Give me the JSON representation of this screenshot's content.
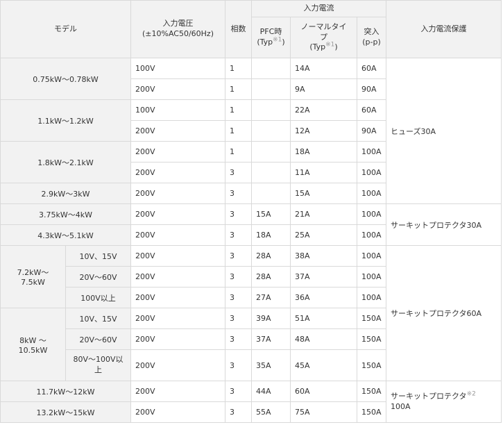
{
  "header": {
    "model": "モデル",
    "voltage_line1": "入力電圧",
    "voltage_line2": "(±10%AC50/60Hz)",
    "phase": "相数",
    "current_group": "入力電流",
    "pfc": "PFC時",
    "pfc_typ": "(Typ",
    "pfc_sup": "※1",
    "pfc_close": ")",
    "normal": "ノーマルタイプ",
    "normal_typ": "(Typ",
    "normal_sup": "※1",
    "normal_close": ")",
    "inrush": "突入",
    "inrush_sub": "(p-p)",
    "protection": "入力電流保護"
  },
  "models": {
    "m1": "0.75kW～0.78kW",
    "m2": "1.1kW～1.2kW",
    "m3": "1.8kW～2.1kW",
    "m4": "2.9kW～3kW",
    "m5": "3.75kW～4kW",
    "m6": "4.3kW～5.1kW",
    "m7": "7.2kW～7.5kW",
    "m8": "8kW ～10.5kW",
    "m9": "11.7kW～12kW",
    "m10": "13.2kW～15kW"
  },
  "submodels": {
    "s1": "10V、15V",
    "s2": "20V～60V",
    "s3": "100V以上",
    "s4": "10V、15V",
    "s5": "20V～60V",
    "s6": "80V～100V以上"
  },
  "rows": [
    {
      "voltage": "100V",
      "phase": "1",
      "pfc": "",
      "normal": "14A",
      "inrush": "60A"
    },
    {
      "voltage": "200V",
      "phase": "1",
      "pfc": "",
      "normal": "9A",
      "inrush": "90A"
    },
    {
      "voltage": "100V",
      "phase": "1",
      "pfc": "",
      "normal": "22A",
      "inrush": "60A"
    },
    {
      "voltage": "200V",
      "phase": "1",
      "pfc": "",
      "normal": "12A",
      "inrush": "90A"
    },
    {
      "voltage": "200V",
      "phase": "1",
      "pfc": "",
      "normal": "18A",
      "inrush": "100A"
    },
    {
      "voltage": "200V",
      "phase": "3",
      "pfc": "",
      "normal": "11A",
      "inrush": "100A"
    },
    {
      "voltage": "200V",
      "phase": "3",
      "pfc": "",
      "normal": "15A",
      "inrush": "100A"
    },
    {
      "voltage": "200V",
      "phase": "3",
      "pfc": "15A",
      "normal": "21A",
      "inrush": "100A"
    },
    {
      "voltage": "200V",
      "phase": "3",
      "pfc": "18A",
      "normal": "25A",
      "inrush": "100A"
    },
    {
      "voltage": "200V",
      "phase": "3",
      "pfc": "28A",
      "normal": "38A",
      "inrush": "100A"
    },
    {
      "voltage": "200V",
      "phase": "3",
      "pfc": "28A",
      "normal": "37A",
      "inrush": "100A"
    },
    {
      "voltage": "200V",
      "phase": "3",
      "pfc": "27A",
      "normal": "36A",
      "inrush": "100A"
    },
    {
      "voltage": "200V",
      "phase": "3",
      "pfc": "39A",
      "normal": "51A",
      "inrush": "150A"
    },
    {
      "voltage": "200V",
      "phase": "3",
      "pfc": "37A",
      "normal": "48A",
      "inrush": "150A"
    },
    {
      "voltage": "200V",
      "phase": "3",
      "pfc": "35A",
      "normal": "45A",
      "inrush": "150A"
    },
    {
      "voltage": "200V",
      "phase": "3",
      "pfc": "44A",
      "normal": "60A",
      "inrush": "150A"
    },
    {
      "voltage": "200V",
      "phase": "3",
      "pfc": "55A",
      "normal": "75A",
      "inrush": "150A"
    }
  ],
  "protection": {
    "p1": "ヒューズ30A",
    "p2": "サーキットプロテクタ30A",
    "p3": "サーキットプロテクタ60A",
    "p4": "サーキットプロテクタ",
    "p4_sup": "※2",
    "p4_value": "100A"
  }
}
